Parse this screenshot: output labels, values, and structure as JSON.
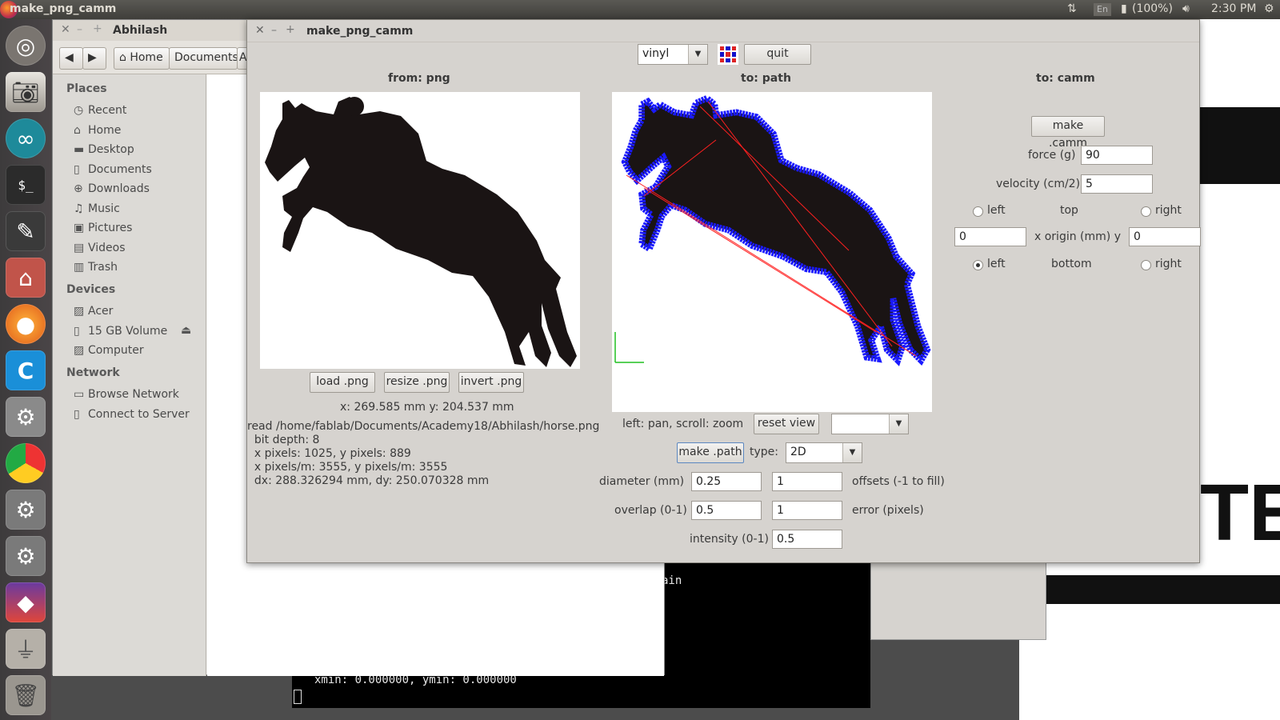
{
  "topbar": {
    "title": "make_png_camm",
    "keyboard": "En",
    "battery": "(100%)",
    "time": "2:30 PM"
  },
  "launcher": {
    "icons": [
      "ubuntu-dash-icon",
      "camera-icon",
      "arduino-icon",
      "terminal-icon",
      "inkscape-icon",
      "files-icon",
      "firefox-icon",
      "c-app-icon",
      "settings-icon",
      "chrome-icon",
      "system-settings-icon",
      "update-settings-icon",
      "firefox-dev-icon",
      "usb-drive-icon",
      "trash-icon"
    ]
  },
  "file_manager": {
    "title": "Abhilash",
    "nav": {
      "back": "◀",
      "forward": "▶",
      "home": "Home",
      "documents": "Documents",
      "more": "A"
    },
    "places_header": "Places",
    "places": [
      "Recent",
      "Home",
      "Desktop",
      "Documents",
      "Downloads",
      "Music",
      "Pictures",
      "Videos",
      "Trash"
    ],
    "devices_header": "Devices",
    "devices": [
      "Acer",
      "15 GB Volume",
      "Computer"
    ],
    "network_header": "Network",
    "network": [
      "Browse Network",
      "Connect to Server"
    ]
  },
  "terminal": {
    "partial_text": "ain",
    "line": "xmin: 0.000000, ymin: 0.000000"
  },
  "dialog": {
    "title": "make_png_camm",
    "machine": "vinyl",
    "quit": "quit",
    "from_header": "from: png",
    "path_header": "to: path",
    "camm_header": "to: camm",
    "load_png": "load .png",
    "resize_png": "resize .png",
    "invert_png": "invert .png",
    "coords": "x: 269.585 mm  y: 204.537 mm",
    "read_info": [
      "read /home/fablab/Documents/Academy18/Abhilash/horse.png",
      "  bit depth: 8",
      "  x pixels: 1025, y pixels: 889",
      "  x pixels/m: 3555, y pixels/m: 3555",
      "  dx: 288.326294 mm, dy: 250.070328 mm"
    ],
    "view_hint": "left: pan, scroll: zoom",
    "reset_view": "reset view",
    "view_select": "",
    "make_path": "make .path",
    "type_label": "type:",
    "type_value": "2D",
    "diameter_label": "diameter (mm)",
    "diameter": "0.25",
    "offsets": "1",
    "offsets_label": "offsets (-1 to fill)",
    "overlap_label": "overlap (0-1)",
    "overlap": "0.5",
    "error": "1",
    "error_label": "error (pixels)",
    "intensity_label": "intensity (0-1)",
    "intensity": "0.5",
    "make_camm": "make .camm",
    "force_label": "force (g)",
    "force": "90",
    "velocity_label": "velocity (cm/2)",
    "velocity": "5",
    "origin_top_left": "left",
    "origin_top": "top",
    "origin_top_right": "right",
    "x_origin": "0",
    "origin_label": "x  origin (mm)  y",
    "y_origin": "0",
    "origin_bottom_left": "left",
    "origin_bottom": "bottom",
    "origin_bottom_right": "right"
  },
  "colors": {
    "path_blue": "#1a1aff",
    "path_red": "#ff2020",
    "axis_green": "#20c020",
    "silhouette": "#1a1414"
  }
}
